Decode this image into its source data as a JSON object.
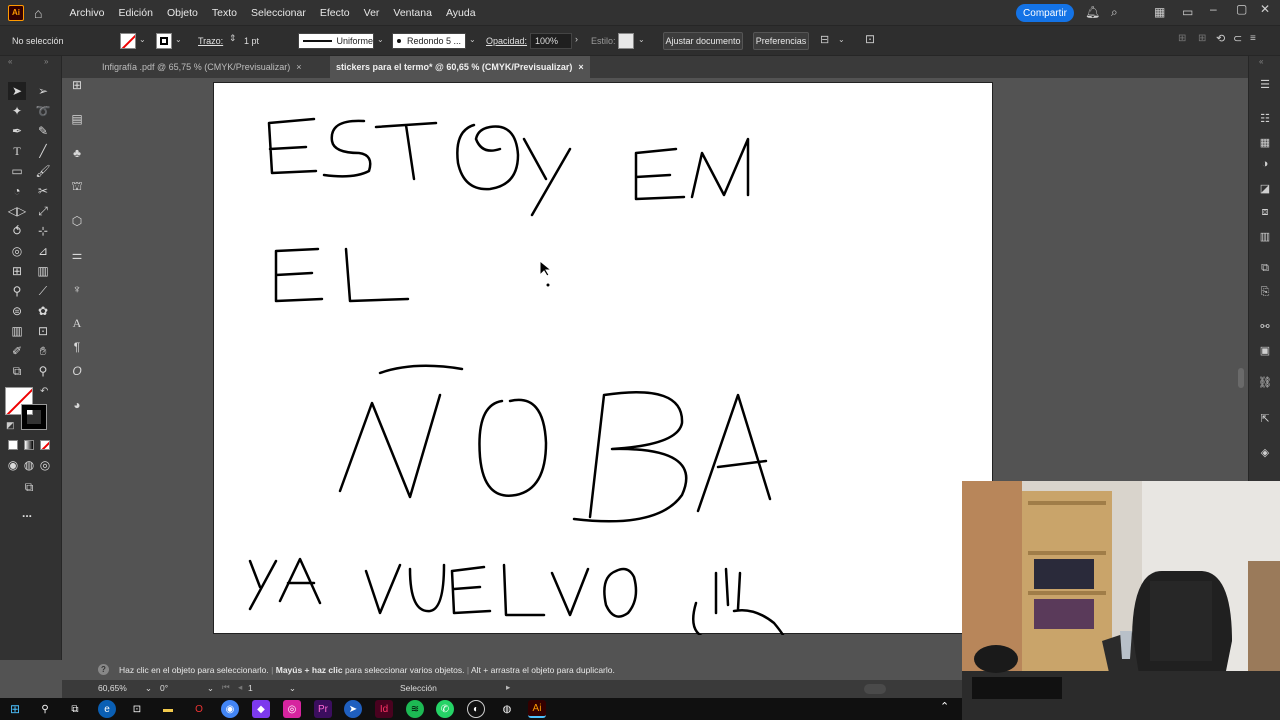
{
  "app": {
    "logo_text": "Ai"
  },
  "menu": [
    "Archivo",
    "Edición",
    "Objeto",
    "Texto",
    "Seleccionar",
    "Efecto",
    "Ver",
    "Ventana",
    "Ayuda"
  ],
  "share_label": "Compartir",
  "control": {
    "selection_status": "No selección",
    "stroke_label": "Trazo:",
    "stroke_value": "1 pt",
    "profile": "Uniforme",
    "brush": "Redondo 5 ...",
    "opacity_label": "Opacidad:",
    "opacity_value": "100%",
    "style_label": "Estilo:",
    "adjust_doc": "Ajustar documento",
    "prefs": "Preferencias"
  },
  "tabs": [
    {
      "label": "Infigrafía .pdf @ 65,75 % (CMYK/Previsualizar)",
      "close": "×"
    },
    {
      "label": "stickers para el termo* @ 60,65 % (CMYK/Previsualizar)",
      "close": "×"
    }
  ],
  "hint": {
    "part1": "Haz clic en el objeto para seleccionarlo.",
    "part2": "Mayús + haz clic",
    "part3": "para seleccionar varios objetos.",
    "part4": "Alt + arrastra el objeto para duplicarlo."
  },
  "status": {
    "zoom": "60,65%",
    "rotation": "0°",
    "artboard": "1",
    "tool": "Selección"
  },
  "toolbar": {
    "more": "..."
  },
  "colors": {
    "accent": "#1473e6",
    "chrome": "#323232",
    "canvas_bg": "#535353",
    "ai_orange": "#ff9a00"
  }
}
